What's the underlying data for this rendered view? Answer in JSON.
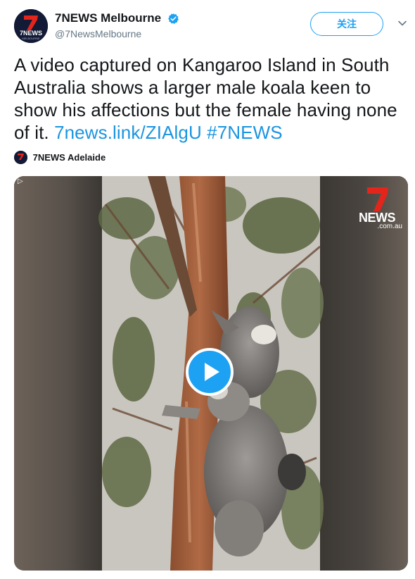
{
  "account": {
    "display_name": "7NEWS Melbourne",
    "handle": "@7NewsMelbourne",
    "avatar_label_main": "7NEWS",
    "avatar_label_sub": "MELBOURNE",
    "verified_icon": "verified-badge-icon"
  },
  "follow_button": {
    "label": "关注"
  },
  "tweet": {
    "text": "A video captured on Kangaroo Island in South Australia shows a larger male koala keen to show his affections but the female having none of it.",
    "link": "7news.link/ZIAlgU",
    "hashtag": "#7NEWS"
  },
  "source": {
    "name": "7NEWS Adelaide"
  },
  "media": {
    "gif_indicator": "▷",
    "logo_word": "NEWS",
    "logo_domain": ".com.au",
    "play_icon": "play-icon"
  },
  "colors": {
    "link": "#1b95e0",
    "follow": "#1da1f2",
    "brand_red": "#e3251c",
    "verified": "#1da1f2"
  }
}
